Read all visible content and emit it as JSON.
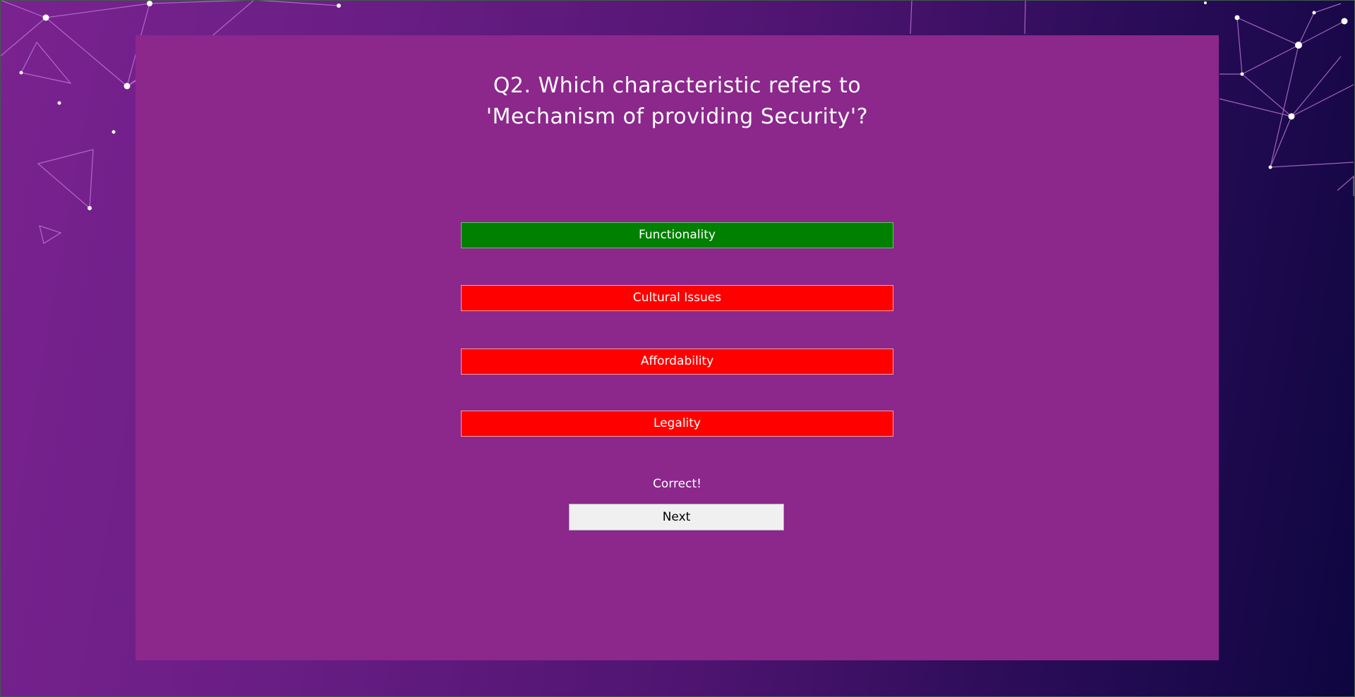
{
  "question": {
    "line1": "Q2. Which characteristic refers to",
    "line2": "'Mechanism of providing Security'?"
  },
  "options": [
    {
      "label": "Functionality",
      "state": "correct"
    },
    {
      "label": "Cultural Issues",
      "state": "wrong"
    },
    {
      "label": "Affordability",
      "state": "wrong"
    },
    {
      "label": "Legality",
      "state": "wrong"
    }
  ],
  "feedback": "Correct!",
  "next_label": "Next",
  "colors": {
    "panel": "#8c278c",
    "correct": "#008000",
    "wrong": "#ff0000",
    "next_bg": "#f0f0f0"
  }
}
